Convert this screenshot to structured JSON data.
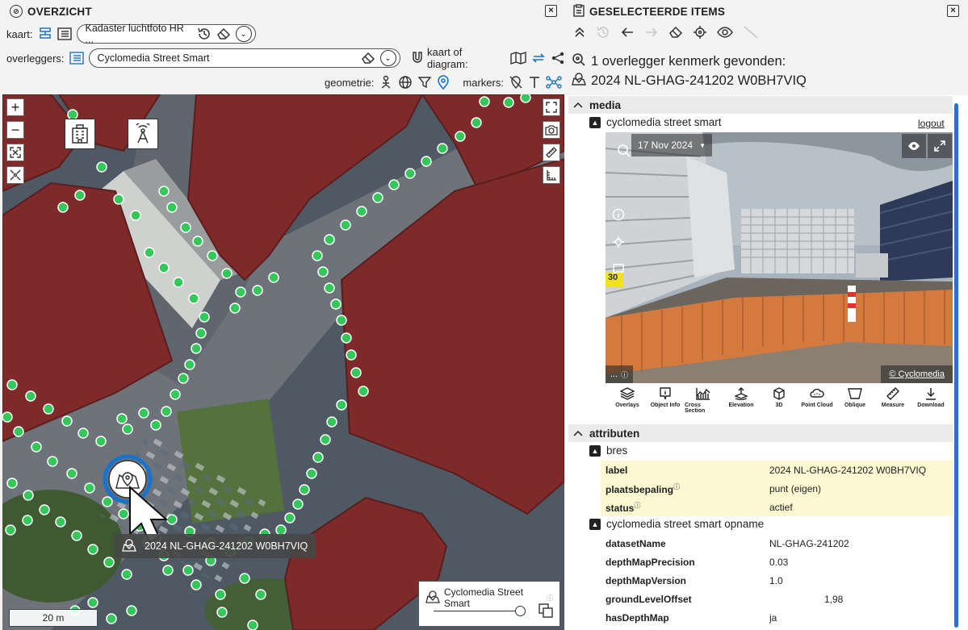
{
  "left_panel": {
    "title": "OVERZICHT",
    "kaart_label": "kaart:",
    "kaart_value": "Kadaster luchtfoto HR ...",
    "overleggers_label": "overleggers:",
    "overleggers_value": "Cyclomedia Street Smart",
    "kaart_of_diagram_label": "kaart of diagram:",
    "geometrie_label": "geometrie:",
    "markers_label": "markers:"
  },
  "map": {
    "tooltip": "2024 NL-GHAG-241202 W0BH7VIQ",
    "scale": "20 m",
    "layer_name": "Cyclomedia Street Smart"
  },
  "right_panel": {
    "title": "GESELECTEERDE ITEMS",
    "found_text": "1 overlegger kenmerk gevonden:",
    "feature_name": "2024 NL-GHAG-241202 W0BH7VIQ",
    "media_section": "media",
    "media_sub": "cyclomedia street smart",
    "logout": "logout",
    "viewer_date": "17 Nov 2024",
    "viewer_badge": "30",
    "viewer_copyright": "© Cyclomedia",
    "viewer_more": "...",
    "toolbar": [
      "Overlays",
      "Object Info",
      "Cross Section",
      "Elevation",
      "3D",
      "Point Cloud",
      "Oblique",
      "Measure",
      "Download"
    ],
    "attributes_section": "attributen",
    "bres_group": "bres",
    "bres_rows": [
      {
        "key": "label",
        "value": "2024 NL-GHAG-241202 W0BH7VIQ",
        "info": false
      },
      {
        "key": "plaatsbepaling",
        "value": "punt (eigen)",
        "info": true
      },
      {
        "key": "status",
        "value": "actief",
        "info": true
      }
    ],
    "opname_group": "cyclomedia street smart opname",
    "opname_rows": [
      {
        "key": "datasetName",
        "value": "NL-GHAG-241202"
      },
      {
        "key": "depthMapPrecision",
        "value": "0.03"
      },
      {
        "key": "depthMapVersion",
        "value": "1.0"
      },
      {
        "key": "groundLevelOffset",
        "value": "1,98"
      },
      {
        "key": "hasDepthMap",
        "value": "ja"
      }
    ]
  },
  "colors": {
    "building_red": "#7e2a2a",
    "point_green": "#34c759",
    "accent_blue": "#1a73c8",
    "highlight_yellow": "#fbf8d2"
  }
}
